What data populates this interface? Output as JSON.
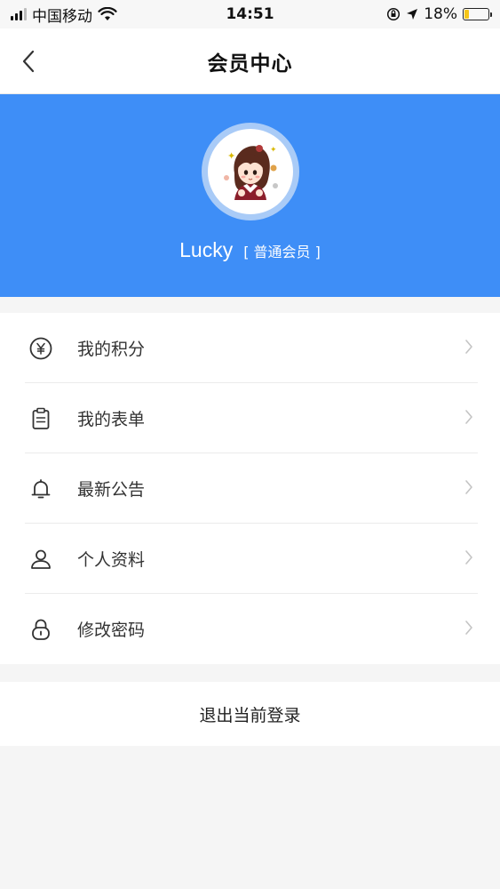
{
  "status_bar": {
    "carrier": "中国移动",
    "time": "14:51",
    "battery_percent": "18%",
    "battery_level": 0.18,
    "icons": [
      "signal-icon",
      "wifi-icon",
      "orientation-lock-icon",
      "location-icon",
      "battery-icon"
    ]
  },
  "header": {
    "title": "会员中心",
    "back_icon": "chevron-left-icon"
  },
  "profile": {
    "username": "Lucky",
    "level": "[ 普通会员 ]",
    "banner_color": "#3e8ef7"
  },
  "menu": {
    "items": [
      {
        "label": "我的积分",
        "icon": "yen-coin-icon"
      },
      {
        "label": "我的表单",
        "icon": "clipboard-icon"
      },
      {
        "label": "最新公告",
        "icon": "bell-icon"
      },
      {
        "label": "个人资料",
        "icon": "user-icon"
      },
      {
        "label": "修改密码",
        "icon": "lock-icon"
      }
    ]
  },
  "logout": {
    "label": "退出当前登录"
  }
}
